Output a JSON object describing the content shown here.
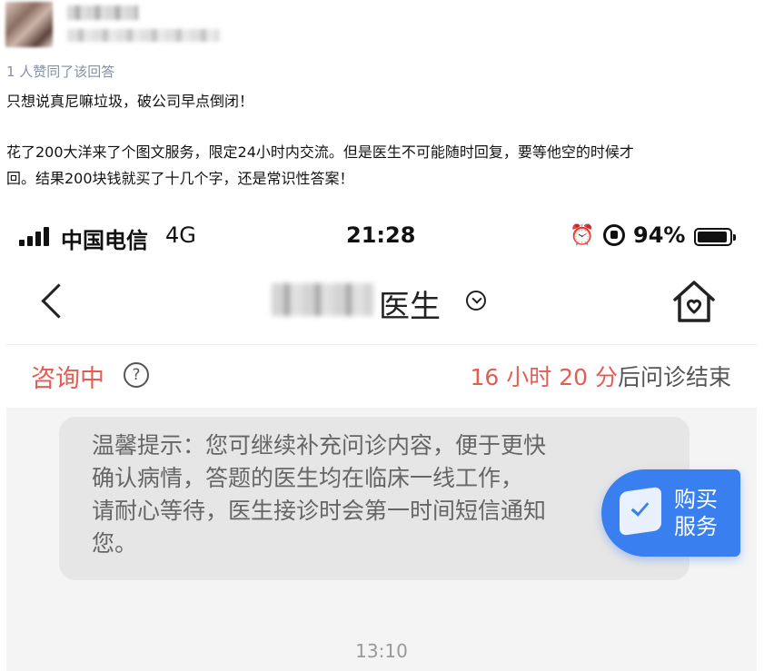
{
  "post": {
    "likes": "1 人赞同了该回答",
    "paragraphs": [
      "只想说真尼嘛垃圾，破公司早点倒闭！",
      "花了200大洋来了个图文服务，限定24小时内交流。但是医生不可能随时回复，要等他空的时候才",
      "回。结果200块钱就买了十几个字，还是常识性答案！"
    ]
  },
  "phone": {
    "status_bar": {
      "carrier": "中国电信",
      "network": "4G",
      "time": "21:28",
      "battery": "94%",
      "battery_level": 0.94,
      "icons": [
        "signal-icon",
        "alarm-icon",
        "rotation-lock-icon",
        "battery-icon"
      ]
    },
    "nav": {
      "title": "医生",
      "icons": [
        "back-icon",
        "chevron-down-icon",
        "home-icon"
      ]
    },
    "consult": {
      "status": "咨询中",
      "help": "?",
      "countdown_value": "16 小时 20 分",
      "countdown_suffix": "后问诊结束"
    },
    "chat": {
      "tip_lines": [
        "温馨提示：您可继续补充问诊内容，便于更快",
        "确认病情，答题的医生均在临床一线工作，",
        "请耐心等待，医生接诊时会第一时间短信通知",
        "您。"
      ],
      "buy_service_line1": "购买",
      "buy_service_line2": "服务",
      "timestamp": "13:10"
    },
    "colors": {
      "accent_red": "#e35d55",
      "button_blue": "#3a7ff0",
      "chat_bg": "#f4f4f4",
      "tip_bg": "#e6e6e6"
    }
  }
}
